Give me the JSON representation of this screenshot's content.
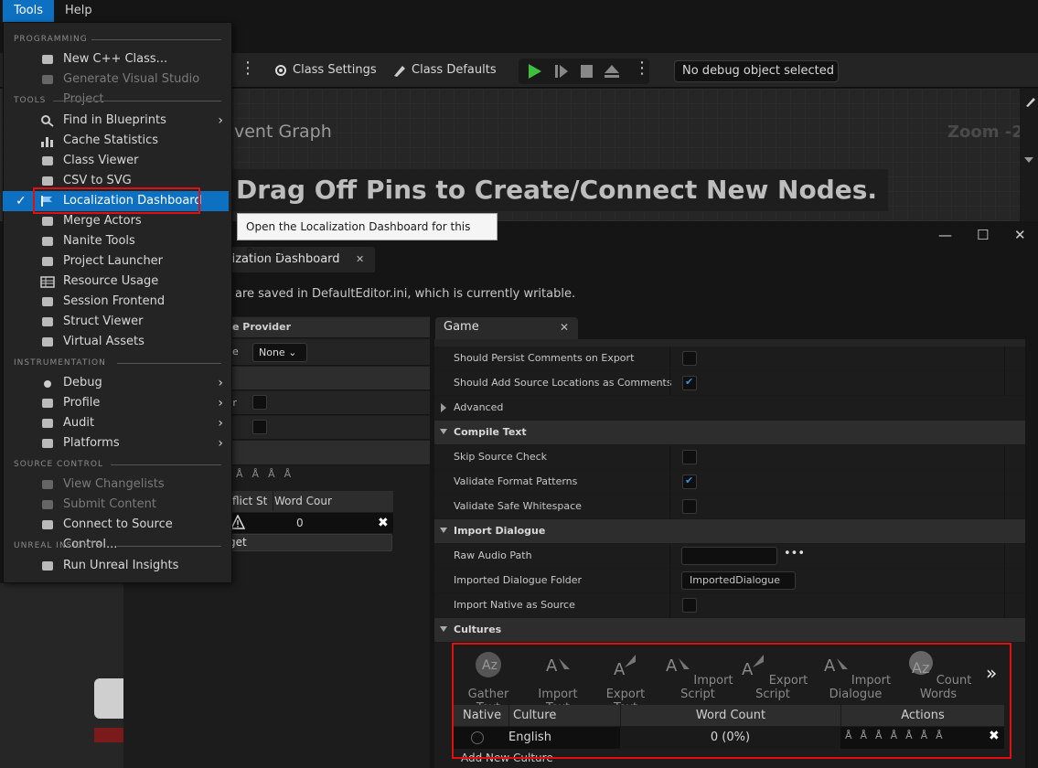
{
  "menubar": {
    "tools": "Tools",
    "help": "Help"
  },
  "toolbar": {
    "class_settings": "Class Settings",
    "class_defaults": "Class Defaults",
    "debug_select": "No debug object selected"
  },
  "graph": {
    "title": "vent Graph",
    "zoom": "Zoom -2",
    "hint": "Drag Off Pins to Create/Connect New Nodes."
  },
  "tooltip": "Open the Localization Dashboard for this Project.",
  "loc": {
    "tab_label": "alization Dashboard",
    "info": "are saved in DefaultEditor.ini, which is currently writable.",
    "provider_header": "e Provider",
    "provider_field": "e",
    "provider_value": "None",
    "row_a": "tr",
    "row_b": "t",
    "conflict_header": "flict St",
    "word_count_header": "Word Cour",
    "word_count_value": "0",
    "target_btn": "get"
  },
  "game_tab": "Game",
  "details": {
    "rows": [
      {
        "label": "Should Persist Comments on Export",
        "checked": false
      },
      {
        "label": "Should Add Source Locations as Comments",
        "checked": true
      }
    ],
    "advanced": "Advanced",
    "compile_text": "Compile Text",
    "compile_rows": [
      {
        "label": "Skip Source Check",
        "checked": false
      },
      {
        "label": "Validate Format Patterns",
        "checked": true
      },
      {
        "label": "Validate Safe Whitespace",
        "checked": false
      }
    ],
    "import_dialogue": "Import Dialogue",
    "raw_audio_path": "Raw Audio Path",
    "raw_audio_value": "",
    "imported_dialogue_folder": "Imported Dialogue Folder",
    "imported_dialogue_value": "ImportedDialogue",
    "import_native": "Import Native as Source",
    "cultures": "Cultures"
  },
  "cultures": {
    "tools": [
      "Gather Text",
      "Import Text",
      "Export Text",
      "Import Script",
      "Export Script",
      "Import Dialogue",
      "Count Words"
    ],
    "headers": {
      "native": "Native",
      "culture": "Culture",
      "word_count": "Word Count",
      "actions": "Actions"
    },
    "row": {
      "culture": "English",
      "word_count": "0 (0%)"
    },
    "add_new": "Add New Culture"
  },
  "menu": {
    "sections": {
      "programming": "PROGRAMMING",
      "tools": "TOOLS",
      "instrumentation": "INSTRUMENTATION",
      "source_control": "SOURCE CONTROL",
      "unreal_insights": "UNREAL INSIGHTS"
    },
    "programming": [
      {
        "label": "New C++ Class...",
        "icon": "cpp-class-icon"
      },
      {
        "label": "Generate Visual Studio Project",
        "icon": "visual-studio-icon",
        "disabled": true
      }
    ],
    "tools": [
      {
        "label": "Find in Blueprints",
        "icon": "search-icon",
        "submenu": true
      },
      {
        "label": "Cache Statistics",
        "icon": "bar-chart-icon"
      },
      {
        "label": "Class Viewer",
        "icon": "class-viewer-icon"
      },
      {
        "label": "CSV to SVG",
        "icon": "csv-icon"
      },
      {
        "label": "Localization Dashboard",
        "icon": "flag-icon",
        "selected": true
      },
      {
        "label": "Merge Actors",
        "icon": "merge-icon"
      },
      {
        "label": "Nanite Tools",
        "icon": "nanite-icon"
      },
      {
        "label": "Project Launcher",
        "icon": "launcher-icon"
      },
      {
        "label": "Resource Usage",
        "icon": "table-icon"
      },
      {
        "label": "Session Frontend",
        "icon": "session-icon"
      },
      {
        "label": "Struct Viewer",
        "icon": "struct-icon"
      },
      {
        "label": "Virtual Assets",
        "icon": "virtual-assets-icon"
      }
    ],
    "instrumentation": [
      {
        "label": "Debug",
        "icon": "bug-icon",
        "submenu": true
      },
      {
        "label": "Profile",
        "icon": "profile-icon",
        "submenu": true
      },
      {
        "label": "Audit",
        "icon": "audit-icon",
        "submenu": true
      },
      {
        "label": "Platforms",
        "icon": "platforms-icon",
        "submenu": true
      }
    ],
    "source_control": [
      {
        "label": "View Changelists",
        "icon": "changelist-icon",
        "disabled": true
      },
      {
        "label": "Submit Content",
        "icon": "submit-icon",
        "disabled": true
      },
      {
        "label": "Connect to Source Control...",
        "icon": "connect-icon"
      }
    ],
    "unreal_insights": [
      {
        "label": "Run Unreal Insights",
        "icon": "insights-icon"
      }
    ]
  },
  "colors": {
    "accent": "#0e70c0",
    "highlight_box": "#e01010",
    "play_green": "#3fbf3f"
  }
}
